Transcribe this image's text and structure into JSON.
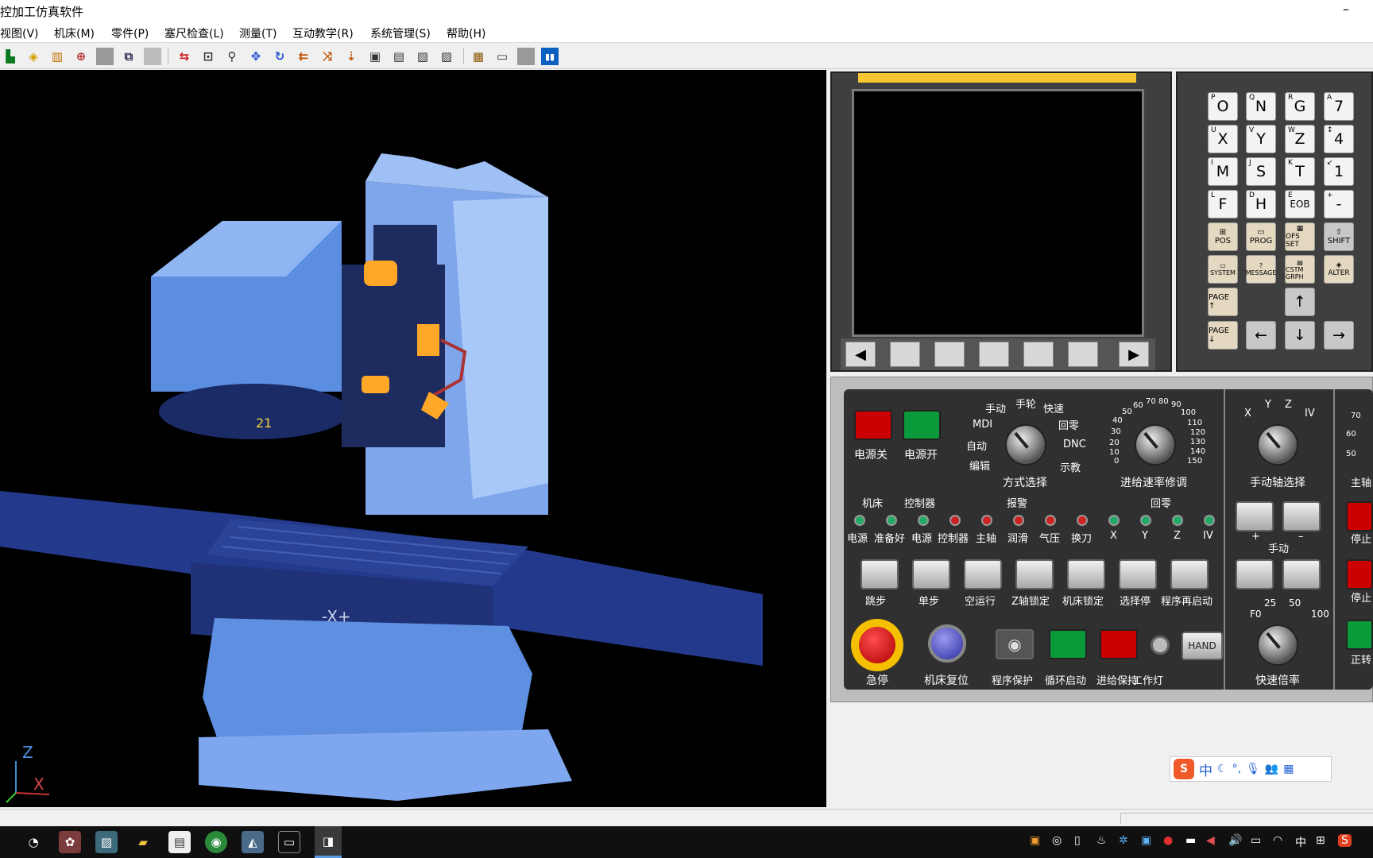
{
  "window": {
    "title": "控加工仿真软件",
    "minimize": "–"
  },
  "menu": [
    "视图(V)",
    "机床(M)",
    "零件(P)",
    "塞尺检查(L)",
    "测量(T)",
    "互动教学(R)",
    "系统管理(S)",
    "帮助(H)"
  ],
  "viewport": {
    "tool_number": "21",
    "axis_label": "-X+",
    "axes": {
      "z": "Z",
      "x": "X"
    }
  },
  "keypad": {
    "row1": [
      "O",
      "N",
      "G",
      "7"
    ],
    "row1_sub": [
      "P",
      "Q",
      "R",
      "A"
    ],
    "row2": [
      "X",
      "Y",
      "Z",
      "4"
    ],
    "row2_sub": [
      "U",
      "V",
      "W",
      "↕"
    ],
    "row3": [
      "M",
      "S",
      "T",
      "1"
    ],
    "row3_sub": [
      "I",
      "J",
      "K",
      "↙"
    ],
    "row4": [
      "F",
      "H",
      "EOB",
      "-"
    ],
    "row4_sub": [
      "L",
      "D",
      "E",
      "+"
    ],
    "row5": [
      "POS",
      "PROG",
      "OFS SET",
      "SHIFT"
    ],
    "row6": [
      "SYSTEM",
      "MESSAGE",
      "CSTM GRPH",
      "ALTER"
    ],
    "page_up": "PAGE ↑",
    "page_down": "PAGE ↓",
    "arrows": {
      "up": "↑",
      "down": "↓",
      "left": "←",
      "right": "→"
    }
  },
  "softkeys": {
    "left": "◀",
    "right": "▶"
  },
  "panel": {
    "power_off": "电源关",
    "power_on": "电源开",
    "mode_options": [
      "手动",
      "手轮",
      "快速",
      "MDI",
      "回零",
      "自动",
      "DNC",
      "编辑",
      "示教"
    ],
    "mode_select": "方式选择",
    "feed_scale": [
      "50",
      "60",
      "70",
      "80",
      "90",
      "100",
      "110",
      "120",
      "130",
      "140",
      "150",
      "40",
      "30",
      "20",
      "10",
      "0"
    ],
    "feed_override": "进给速率修调",
    "axis_options": [
      "X",
      "Y",
      "Z",
      "IV"
    ],
    "axis_select": "手动轴选择",
    "group_labels": {
      "machine": "机床",
      "controller": "控制器",
      "alarm": "报警",
      "home": "回零"
    },
    "led_labels": [
      "电源",
      "准备好",
      "电源",
      "控制器",
      "主轴",
      "润滑",
      "气压",
      "换刀",
      "X",
      "Y",
      "Z",
      "IV"
    ],
    "func_buttons": [
      "跳步",
      "单步",
      "空运行",
      "Z轴锁定",
      "机床锁定",
      "选择停",
      "程序再启动"
    ],
    "jog_plus": "+",
    "jog_minus": "–",
    "jog_label": "手动",
    "bottom_labels": [
      "急停",
      "机床复位",
      "程序保护",
      "循环启动",
      "进给保持",
      "工作灯"
    ],
    "hand_button": "HAND",
    "rapid_scale": [
      "F0",
      "25",
      "50",
      "100"
    ],
    "rapid_override": "快速倍率",
    "spindle_partial": [
      "主轴",
      "停止",
      "停止",
      "正转"
    ],
    "spindle_scale_partial": [
      "70",
      "60",
      "50"
    ]
  },
  "ime": {
    "language": "中"
  },
  "taskbar": {
    "ime_lang": "中"
  }
}
